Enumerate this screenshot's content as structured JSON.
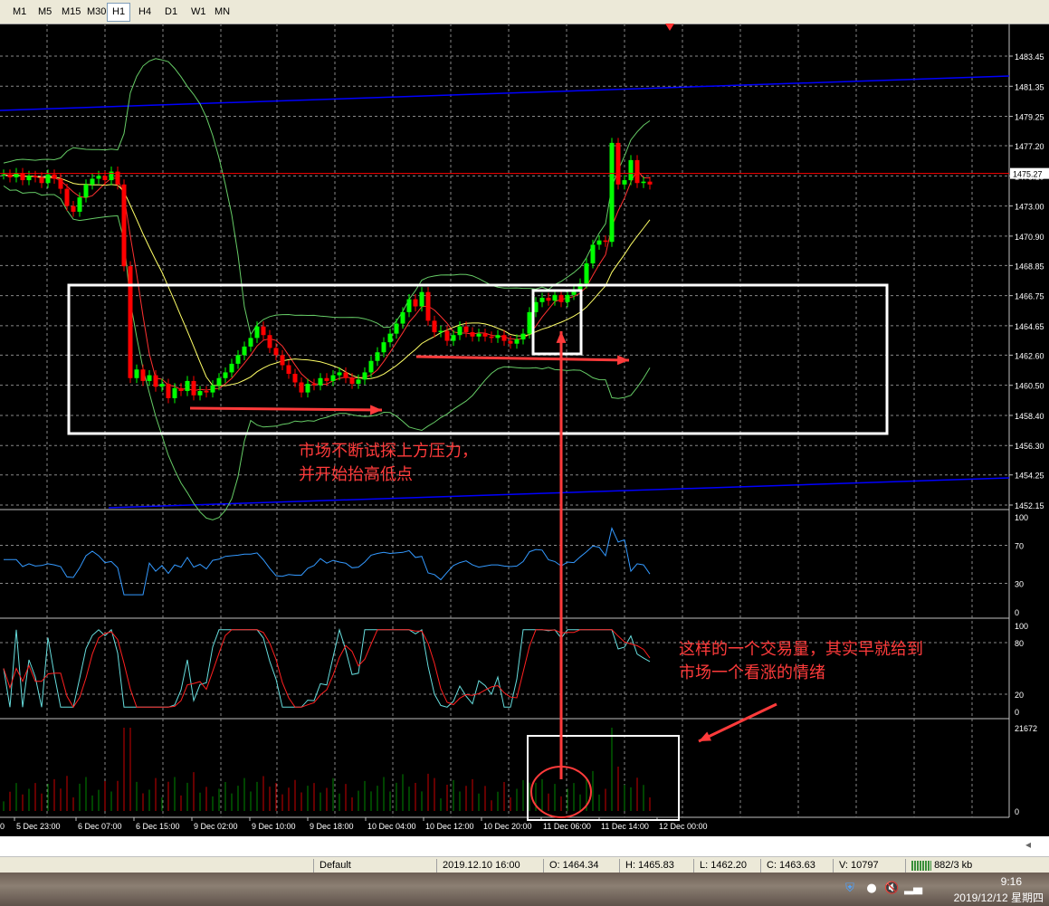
{
  "toolbar": {
    "timeframes": [
      "M1",
      "M5",
      "M15",
      "M30",
      "H1",
      "H4",
      "D1",
      "W1",
      "MN"
    ],
    "active": "H1"
  },
  "price_axis": {
    "labels": [
      "1483.45",
      "1481.35",
      "1479.25",
      "1477.20",
      "1475.10",
      "1473.00",
      "1470.90",
      "1468.85",
      "1466.75",
      "1464.65",
      "1462.60",
      "1460.50",
      "1458.40",
      "1456.30",
      "1454.25",
      "1452.15"
    ],
    "current_price": "1475.27"
  },
  "rsi_axis": [
    "100",
    "70",
    "30",
    "0"
  ],
  "stoch_axis": [
    "100",
    "80",
    "20",
    "0"
  ],
  "volume_axis": [
    "21672",
    "0"
  ],
  "time_axis": [
    "5 Dec 23:00",
    "6 Dec 07:00",
    "6 Dec 15:00",
    "9 Dec 02:00",
    "9 Dec 10:00",
    "9 Dec 18:00",
    "10 Dec 04:00",
    "10 Dec 12:00",
    "10 Dec 20:00",
    "11 Dec 06:00",
    "11 Dec 14:00",
    "12 Dec 00:00"
  ],
  "time_axis_first": "0",
  "annotations": {
    "price_note_line1": "市场不断试探上方压力，",
    "price_note_line2": "并开始抬高低点",
    "volume_note_line1": "这样的一个交易量，其实早就给到",
    "volume_note_line2": "市场一个看涨的情绪"
  },
  "status": {
    "profile": "Default",
    "datetime": "2019.12.10 16:00",
    "open": "O: 1464.34",
    "high": "H: 1465.83",
    "low": "L: 1462.20",
    "close": "C: 1463.63",
    "volume": "V: 10797",
    "traffic": "882/3 kb"
  },
  "taskbar": {
    "time": "9:16",
    "date": "2019/12/12 星期四"
  },
  "colors": {
    "bull_candle": "#00ff00",
    "bear_candle": "#ff0000",
    "annotation": "#ff3b3b",
    "channel": "#0000ff",
    "bollinger": "#66cc66",
    "rsi": "#3399ff"
  }
}
